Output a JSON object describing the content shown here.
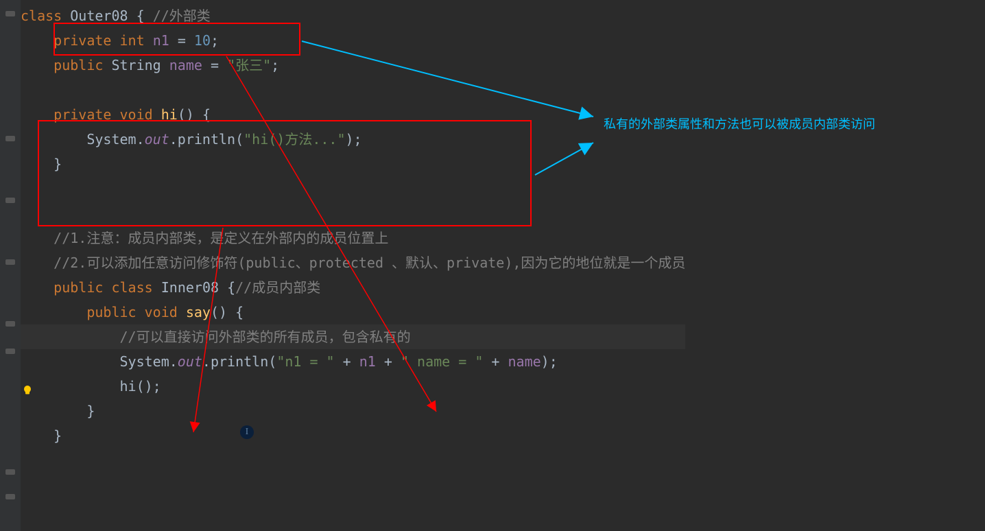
{
  "code": {
    "line1_class": "class",
    "line1_name": "Outer08",
    "line1_brace": " {",
    "line1_comment": " //外部类",
    "line2_private": "private",
    "line2_int": "int",
    "line2_n1": "n1",
    "line2_eq": " = ",
    "line2_val": "10",
    "line2_semi": ";",
    "line3_public": "public",
    "line3_type": "String",
    "line3_name": "name",
    "line3_eq": " = ",
    "line3_val": "\"张三\"",
    "line3_semi": ";",
    "line5_private": "private",
    "line5_void": "void",
    "line5_method": "hi",
    "line5_rest": "() {",
    "line6_sys": "System",
    "line6_dot1": ".",
    "line6_out": "out",
    "line6_dot2": ".",
    "line6_println": "println",
    "line6_paren": "(",
    "line6_str": "\"hi()方法...\"",
    "line6_close": ");",
    "line7_brace": "}",
    "line9_comment": "//1.注意：成员内部类，是定义在外部内的成员位置上",
    "line10_comment": "//2.可以添加任意访问修饰符(public、protected 、默认、private),因为它的地位就是一个成员",
    "line11_public": "public",
    "line11_class": "class",
    "line11_name": "Inner08",
    "line11_brace": " {",
    "line11_comment": "//成员内部类",
    "line12_public": "public",
    "line12_void": "void",
    "line12_method": "say",
    "line12_rest": "() {",
    "line13_comment": "//可以直接访问外部类的所有成员，包含私有的",
    "line14_sys": "System",
    "line14_dot1": ".",
    "line14_out": "out",
    "line14_dot2": ".",
    "line14_println": "println",
    "line14_paren": "(",
    "line14_str1": "\"n1 = \"",
    "line14_plus1": " + ",
    "line14_n1": "n1",
    "line14_plus2": " + ",
    "line14_str2": "\" name = \"",
    "line14_plus3": " + ",
    "line14_name": "name",
    "line14_close": ");",
    "line15_hi": "hi",
    "line15_call": "();",
    "line16_brace": "}",
    "line17_brace": "}"
  },
  "annotation": {
    "text": "私有的外部类属性和方法也可以被成员内部类访问"
  }
}
